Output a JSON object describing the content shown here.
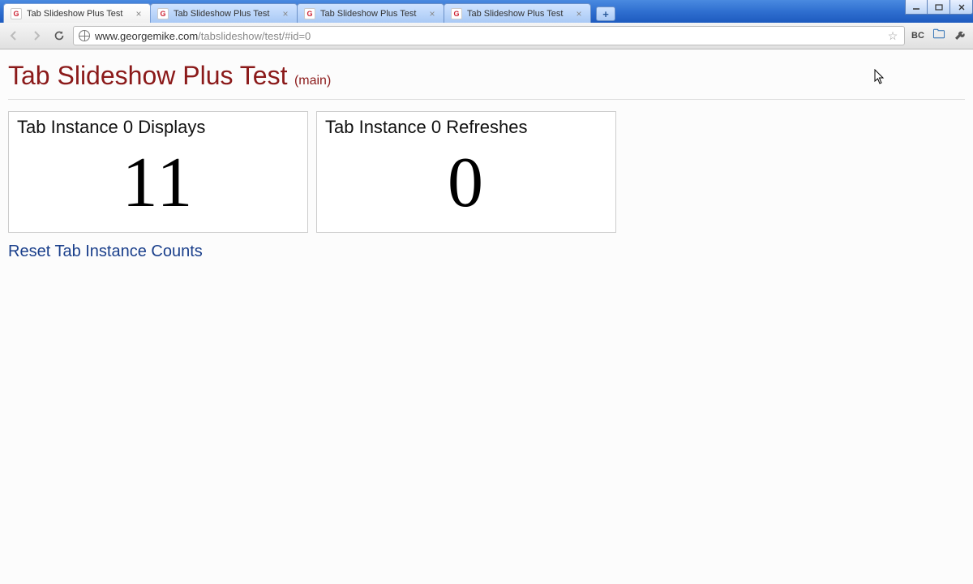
{
  "window": {
    "tabs": [
      {
        "title": "Tab Slideshow Plus Test",
        "active": true
      },
      {
        "title": "Tab Slideshow Plus Test",
        "active": false
      },
      {
        "title": "Tab Slideshow Plus Test",
        "active": false
      },
      {
        "title": "Tab Slideshow Plus Test",
        "active": false
      }
    ],
    "favicon_letter": "G"
  },
  "toolbar": {
    "url_host": "www.georgemike.com",
    "url_path": "/tabslideshow/test/#id=0",
    "ext_bc": "BC"
  },
  "page": {
    "title": "Tab Slideshow Plus Test",
    "subtitle": "(main)",
    "box1_label": "Tab Instance 0 Displays",
    "box1_value": "11",
    "box2_label": "Tab Instance 0 Refreshes",
    "box2_value": "0",
    "reset_link": "Reset Tab Instance Counts"
  }
}
